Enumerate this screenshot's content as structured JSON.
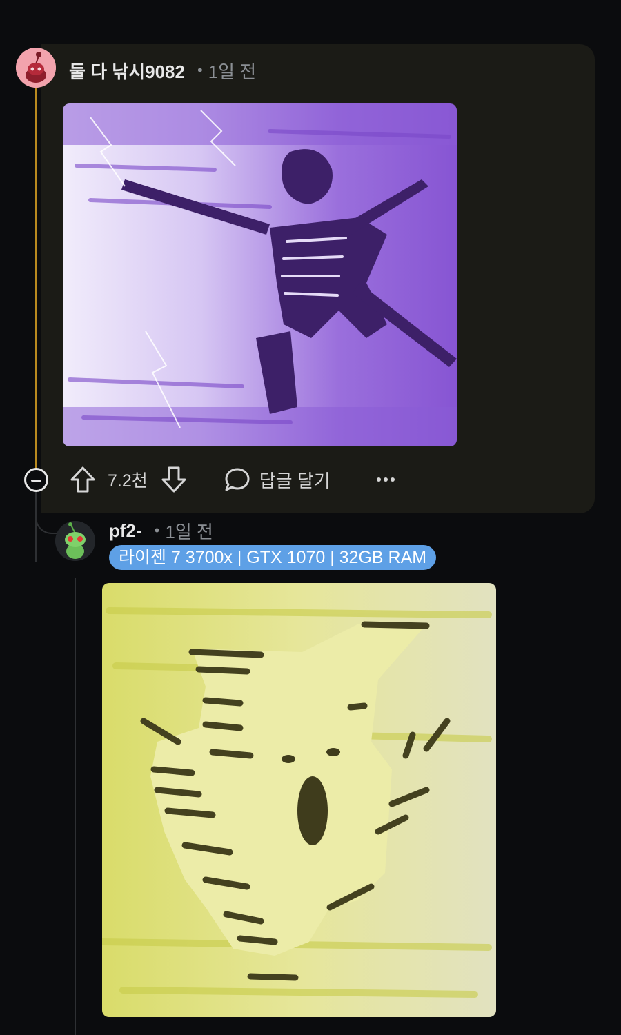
{
  "comments": [
    {
      "username": "둘 다 낚시9082",
      "dot": "•",
      "time": "1일 전",
      "image_desc": "purple-lightning-skeleton",
      "avatar_color": "#f2a3ad",
      "actions": {
        "vote_count": "7.2천",
        "reply_label": "답글 달기",
        "more_label": "···"
      }
    },
    {
      "username": "pf2-",
      "dot": "•",
      "time": "1일 전",
      "flair": "라이젠 7 3700x | GTX 1070 | 32GB RAM",
      "flair_color": "#5ea0e6",
      "image_desc": "yellow-screaming-figure"
    }
  ],
  "colors": {
    "background": "#0b0c0e",
    "highlight_panel": "#1b1b16",
    "thread_line_active": "#b98a1f",
    "thread_line": "#2e3033"
  }
}
